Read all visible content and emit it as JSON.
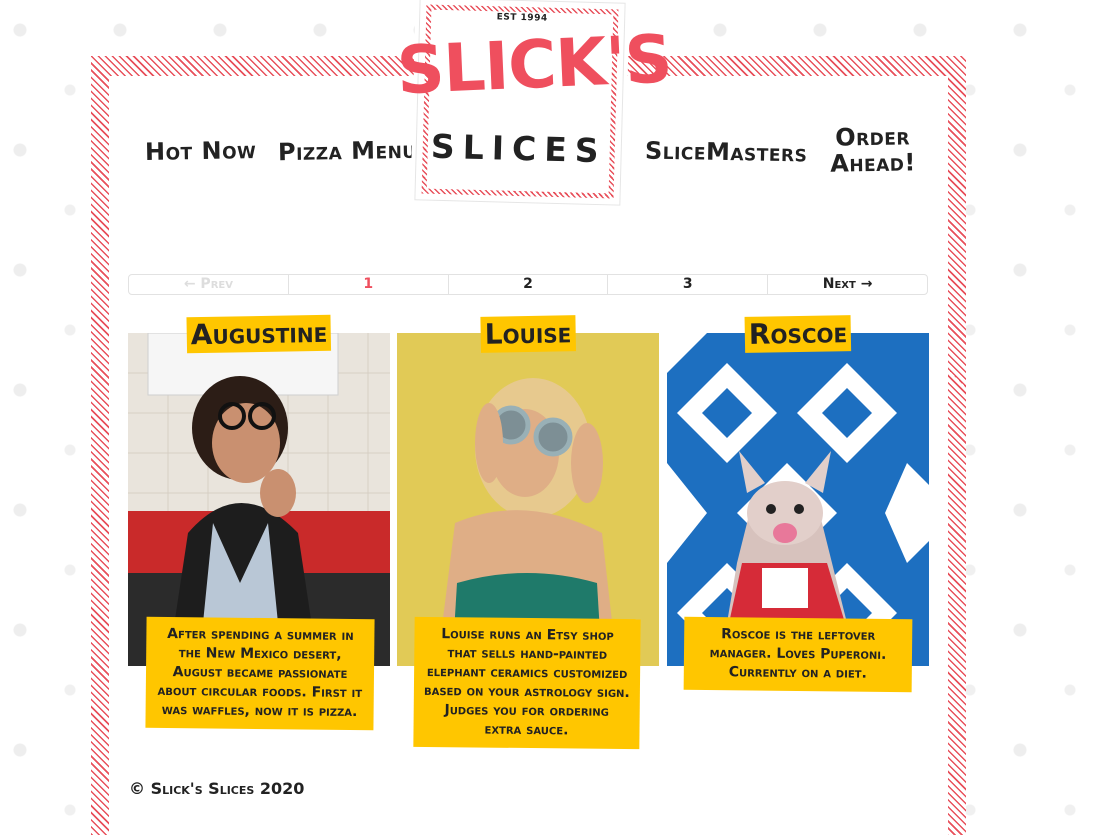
{
  "nav": {
    "hot_now": "Hot Now",
    "pizza_menu": "Pizza Menu",
    "slicemasters": "SliceMasters",
    "order_ahead_line1": "Order",
    "order_ahead_line2": "Ahead!"
  },
  "logo": {
    "est": "EST 1994",
    "top": "SLICK'S",
    "bottom": "SLICES"
  },
  "pagination": {
    "prev": "← Prev",
    "pages": [
      "1",
      "2",
      "3"
    ],
    "next": "Next →",
    "current": "1"
  },
  "slicemasters": [
    {
      "name": "Augustine",
      "description": "After spending a summer in the New Mexico desert, August became passionate about circular foods. First it was waffles, now it is pizza."
    },
    {
      "name": "Louise",
      "description": "Louise runs an Etsy shop that sells hand-painted elephant ceramics customized based on your astrology sign. Judges you for ordering extra sauce."
    },
    {
      "name": "Roscoe",
      "description": "Roscoe is the leftover manager. Loves Puperoni. Currently on a diet."
    }
  ],
  "footer": {
    "copyright": "© Slick's Slices 2020"
  },
  "colors": {
    "accent_red": "#ef4f5e",
    "tag_yellow": "#ffc600",
    "text_dark": "#222222"
  }
}
